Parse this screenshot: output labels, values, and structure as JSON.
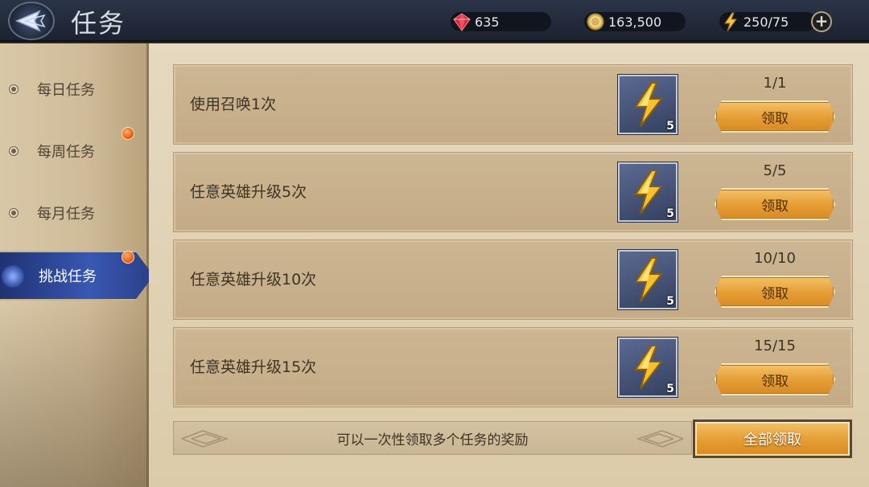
{
  "header": {
    "title": "任务",
    "back_icon": "back-arrow-icon",
    "resources": {
      "gems": "635",
      "coins": "163,500",
      "energy": "250/75"
    },
    "plus_label": "+"
  },
  "sidebar": {
    "items": [
      {
        "label": "每日任务",
        "has_badge": false,
        "active": false
      },
      {
        "label": "每周任务",
        "has_badge": true,
        "active": false
      },
      {
        "label": "每月任务",
        "has_badge": false,
        "active": false
      },
      {
        "label": "挑战任务",
        "has_badge": true,
        "active": true
      }
    ]
  },
  "quests": [
    {
      "name": "使用召唤1次",
      "reward_icon": "lightning-icon",
      "reward_count": "5",
      "progress": "1/1",
      "button_label": "领取"
    },
    {
      "name": "任意英雄升级5次",
      "reward_icon": "lightning-icon",
      "reward_count": "5",
      "progress": "5/5",
      "button_label": "领取"
    },
    {
      "name": "任意英雄升级10次",
      "reward_icon": "lightning-icon",
      "reward_count": "5",
      "progress": "10/10",
      "button_label": "领取"
    },
    {
      "name": "任意英雄升级15次",
      "reward_icon": "lightning-icon",
      "reward_count": "5",
      "progress": "15/15",
      "button_label": "领取"
    }
  ],
  "footer": {
    "hint": "可以一次性领取多个任务的奖励",
    "claim_all_label": "全部领取"
  },
  "colors": {
    "accent_gold": "#e59d33",
    "active_tab_blue": "#3858b4",
    "badge_orange": "#f06010"
  }
}
